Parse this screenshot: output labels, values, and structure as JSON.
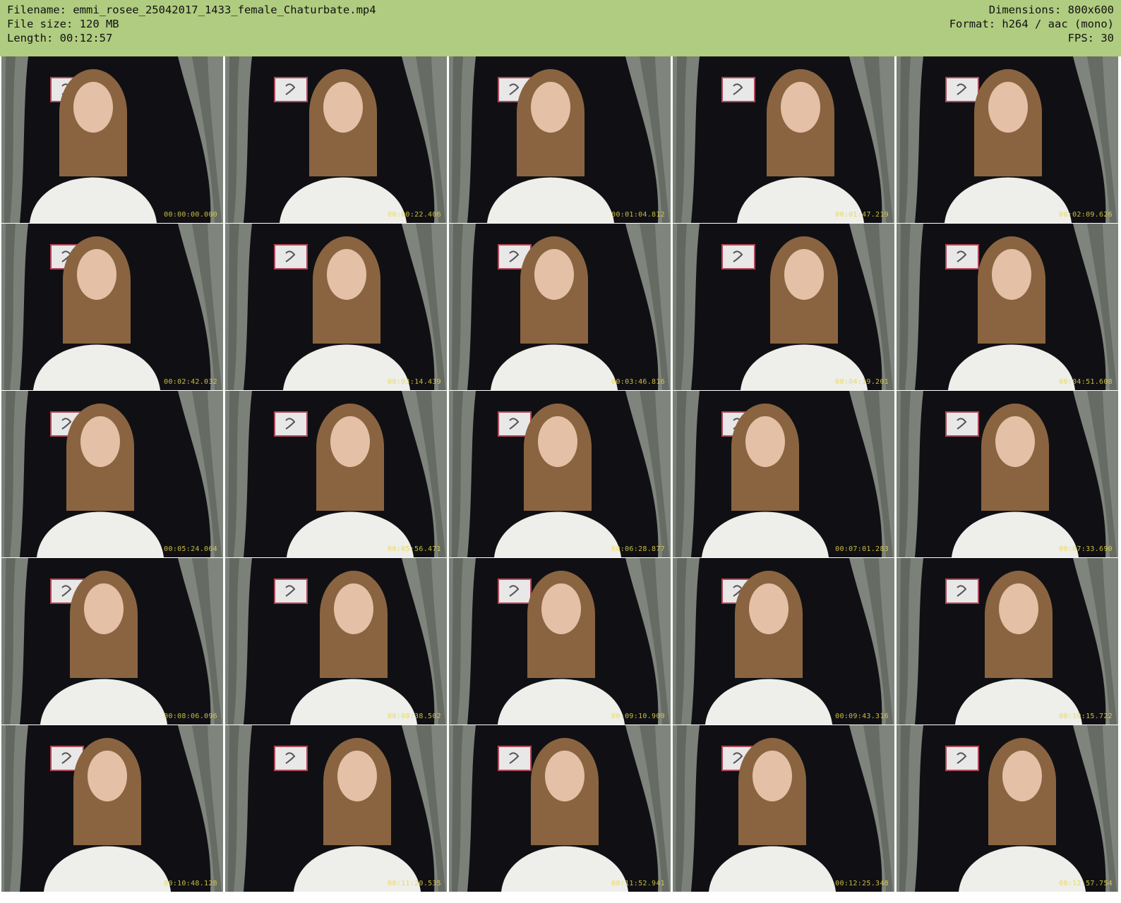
{
  "header": {
    "filename": "Filename: emmi_rosee_25042017_1433_female_Chaturbate.mp4",
    "file_size": "File size: 120 MB",
    "length": "Length: 00:12:57",
    "dimensions": "Dimensions: 800x600",
    "format": "Format: h264 / aac (mono)",
    "fps": "FPS: 30"
  },
  "colors": {
    "header_bg": "#b0cc80",
    "timestamp": "#e7d84a"
  },
  "thumbnails": [
    {
      "timestamp": "00:00:00.000"
    },
    {
      "timestamp": "00:00:22.406"
    },
    {
      "timestamp": "00:01:04.812"
    },
    {
      "timestamp": "00:01:47.219"
    },
    {
      "timestamp": "00:02:09.626"
    },
    {
      "timestamp": "00:02:42.032"
    },
    {
      "timestamp": "00:03:14.439"
    },
    {
      "timestamp": "00:03:46.816"
    },
    {
      "timestamp": "00:04:19.201"
    },
    {
      "timestamp": "00:04:51.608"
    },
    {
      "timestamp": "00:05:24.064"
    },
    {
      "timestamp": "00:05:56.471"
    },
    {
      "timestamp": "00:06:28.877"
    },
    {
      "timestamp": "00:07:01.283"
    },
    {
      "timestamp": "00:07:33.690"
    },
    {
      "timestamp": "00:08:06.096"
    },
    {
      "timestamp": "00:08:38.502"
    },
    {
      "timestamp": "00:09:10.909"
    },
    {
      "timestamp": "00:09:43.316"
    },
    {
      "timestamp": "00:10:15.722"
    },
    {
      "timestamp": "00:10:48.128"
    },
    {
      "timestamp": "00:11:20.535"
    },
    {
      "timestamp": "00:11:52.941"
    },
    {
      "timestamp": "00:12:25.348"
    },
    {
      "timestamp": "00:12:57.754"
    }
  ]
}
